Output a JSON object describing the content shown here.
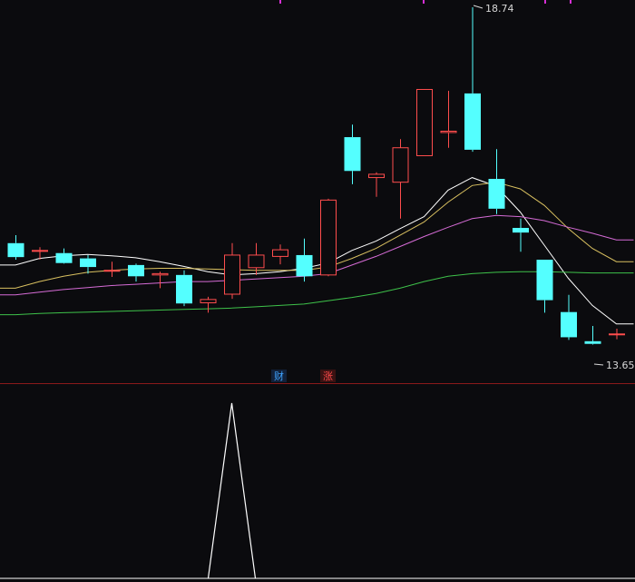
{
  "chart_data": [
    {
      "type": "candlestick",
      "panel": "price",
      "ylim": [
        13.3,
        18.85
      ],
      "high_label": "18.74",
      "low_label": "13.65",
      "colors": {
        "up": "#ff4d4d",
        "down": "#54ffff",
        "background": "#0b0b0e"
      },
      "candles": [
        {
          "o": 15.18,
          "h": 15.3,
          "l": 14.93,
          "c": 14.97
        },
        {
          "o": 15.07,
          "h": 15.12,
          "l": 14.93,
          "c": 15.07
        },
        {
          "o": 15.03,
          "h": 15.1,
          "l": 14.87,
          "c": 14.88
        },
        {
          "o": 14.95,
          "h": 15.0,
          "l": 14.72,
          "c": 14.82
        },
        {
          "o": 14.77,
          "h": 14.9,
          "l": 14.67,
          "c": 14.77
        },
        {
          "o": 14.85,
          "h": 14.87,
          "l": 14.6,
          "c": 14.68
        },
        {
          "o": 14.7,
          "h": 14.75,
          "l": 14.5,
          "c": 14.72
        },
        {
          "o": 14.7,
          "h": 14.77,
          "l": 14.23,
          "c": 14.27
        },
        {
          "o": 14.28,
          "h": 14.37,
          "l": 14.13,
          "c": 14.33
        },
        {
          "o": 14.41,
          "h": 15.18,
          "l": 14.34,
          "c": 15.0
        },
        {
          "o": 14.81,
          "h": 15.18,
          "l": 14.7,
          "c": 15.0
        },
        {
          "o": 14.98,
          "h": 15.16,
          "l": 14.86,
          "c": 15.08
        },
        {
          "o": 15.0,
          "h": 15.25,
          "l": 14.6,
          "c": 14.68
        },
        {
          "o": 14.7,
          "h": 15.85,
          "l": 14.68,
          "c": 15.83
        },
        {
          "o": 16.78,
          "h": 16.97,
          "l": 16.07,
          "c": 16.27
        },
        {
          "o": 16.17,
          "h": 16.25,
          "l": 15.88,
          "c": 16.22
        },
        {
          "o": 16.1,
          "h": 16.75,
          "l": 15.55,
          "c": 16.62
        },
        {
          "o": 16.5,
          "h": 17.5,
          "l": 16.5,
          "c": 17.5
        },
        {
          "o": 16.85,
          "h": 17.48,
          "l": 16.62,
          "c": 16.87
        },
        {
          "o": 17.44,
          "h": 18.74,
          "l": 16.56,
          "c": 16.59
        },
        {
          "o": 16.15,
          "h": 16.6,
          "l": 15.62,
          "c": 15.7
        },
        {
          "o": 15.41,
          "h": 15.55,
          "l": 15.05,
          "c": 15.34
        },
        {
          "o": 14.93,
          "h": 14.93,
          "l": 14.13,
          "c": 14.32
        },
        {
          "o": 14.14,
          "h": 14.4,
          "l": 13.72,
          "c": 13.76
        },
        {
          "o": 13.7,
          "h": 13.93,
          "l": 13.65,
          "c": 13.66
        },
        {
          "o": 13.81,
          "h": 13.89,
          "l": 13.73,
          "c": 13.81
        }
      ],
      "ma_lines": [
        {
          "color": "#ffffff",
          "values": [
            14.85,
            14.95,
            14.99,
            15.01,
            14.99,
            14.96,
            14.9,
            14.83,
            14.75,
            14.7,
            14.72,
            14.75,
            14.8,
            14.88,
            15.07,
            15.21,
            15.4,
            15.58,
            15.98,
            16.17,
            16.04,
            15.65,
            15.15,
            14.65,
            14.24,
            13.96
          ]
        },
        {
          "color": "#d9c060",
          "values": [
            14.5,
            14.6,
            14.68,
            14.74,
            14.77,
            14.79,
            14.8,
            14.8,
            14.79,
            14.78,
            14.77,
            14.77,
            14.77,
            14.82,
            14.95,
            15.1,
            15.3,
            15.5,
            15.8,
            16.05,
            16.1,
            16.0,
            15.75,
            15.4,
            15.1,
            14.9
          ]
        },
        {
          "color": "#d56bd5",
          "values": [
            14.4,
            14.44,
            14.48,
            14.51,
            14.54,
            14.56,
            14.58,
            14.6,
            14.6,
            14.62,
            14.64,
            14.66,
            14.68,
            14.72,
            14.85,
            14.98,
            15.13,
            15.28,
            15.42,
            15.55,
            15.6,
            15.58,
            15.52,
            15.42,
            15.33,
            15.23
          ]
        },
        {
          "color": "#3ec24a",
          "values": [
            14.1,
            14.12,
            14.13,
            14.14,
            14.15,
            14.16,
            14.17,
            14.18,
            14.19,
            14.2,
            14.22,
            14.24,
            14.26,
            14.31,
            14.36,
            14.42,
            14.5,
            14.6,
            14.68,
            14.72,
            14.74,
            14.75,
            14.75,
            14.74,
            14.73,
            14.73
          ]
        }
      ]
    },
    {
      "type": "line",
      "panel": "indicator",
      "ylim": [
        0,
        1
      ],
      "color": "#ffffff",
      "values": [
        0,
        0,
        0,
        0,
        0,
        0,
        0,
        0,
        0,
        1,
        0,
        0,
        0,
        0,
        0,
        0,
        0,
        0,
        0,
        0,
        0,
        0,
        0,
        0,
        0,
        0
      ]
    }
  ],
  "markers": [
    {
      "text": "财",
      "color": "#3fa3ff"
    },
    {
      "text": "涨",
      "color": "#ff4a4a"
    }
  ]
}
